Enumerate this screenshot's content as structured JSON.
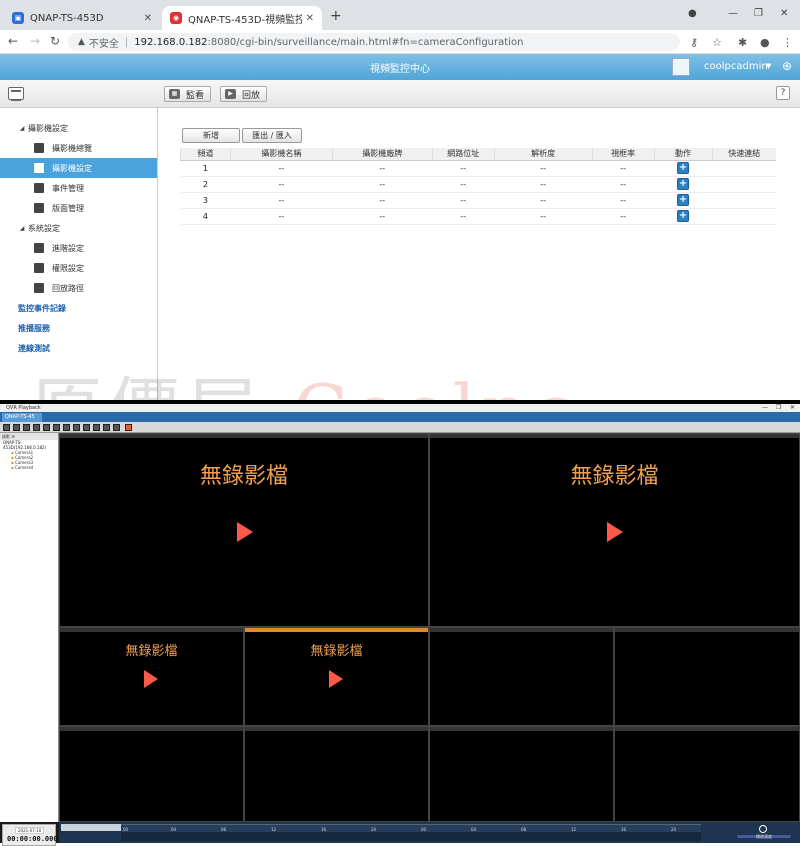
{
  "browser": {
    "tabs": [
      {
        "title": "QNAP-TS-453D",
        "active": false
      },
      {
        "title": "QNAP-TS-453D-視頻監控中心",
        "active": true
      }
    ],
    "address": {
      "insecure_label": "不安全",
      "host": "192.168.0.182",
      "path": ":8080/cgi-bin/surveillance/main.html#fn=cameraConfiguration"
    }
  },
  "app": {
    "title": "視頻監控中心",
    "username": "coolpcadmin",
    "toolbar": {
      "monitor_label": "監看",
      "playback_label": "回放",
      "help_label": "?"
    }
  },
  "sidebar": {
    "groups": [
      {
        "label": "攝影機設定",
        "items": [
          "攝影機總覽",
          "攝影機設定",
          "事件管理",
          "版面管理"
        ]
      },
      {
        "label": "系統設定",
        "items": [
          "進階設定",
          "權限設定",
          "回放路徑"
        ]
      }
    ],
    "selected": "攝影機設定",
    "links": [
      "監控事件記錄",
      "推播服務",
      "連線測試"
    ]
  },
  "camera_config": {
    "buttons": {
      "add": "新增",
      "import_export": "匯出 / 匯入"
    },
    "columns": [
      "頻道",
      "攝影機名稱",
      "攝影機廠牌",
      "網路位址",
      "解析度",
      "視框率",
      "動作",
      "快速連結"
    ],
    "rows": [
      {
        "channel": "1",
        "name": "--",
        "brand": "--",
        "ip": "--",
        "resolution": "--",
        "fps": "--"
      },
      {
        "channel": "2",
        "name": "--",
        "brand": "--",
        "ip": "--",
        "resolution": "--",
        "fps": "--"
      },
      {
        "channel": "3",
        "name": "--",
        "brand": "--",
        "ip": "--",
        "resolution": "--",
        "fps": "--"
      },
      {
        "channel": "4",
        "name": "--",
        "brand": "--",
        "ip": "--",
        "resolution": "--",
        "fps": "--"
      }
    ]
  },
  "watermark": {
    "text_a": "原價屋",
    "text_o": "Coolpc"
  },
  "qvr": {
    "window_title": "QVR Playback",
    "tab_label": "QNAP-TS-45",
    "tree": {
      "header": "錄影 ☰",
      "server": "QNAP-TS-453D(192.168.0.182)",
      "cameras": [
        "Camera1",
        "Camera2",
        "Camera3",
        "Camera4"
      ]
    },
    "no_recording_text": "無錄影檔",
    "date": "2021-07-10",
    "time": "00:00:00.000",
    "timeline_ticks": [
      "00",
      "04",
      "08",
      "12",
      "16",
      "20",
      "00",
      "04",
      "08",
      "12",
      "16",
      "20"
    ],
    "speed_label": "播放速度"
  }
}
